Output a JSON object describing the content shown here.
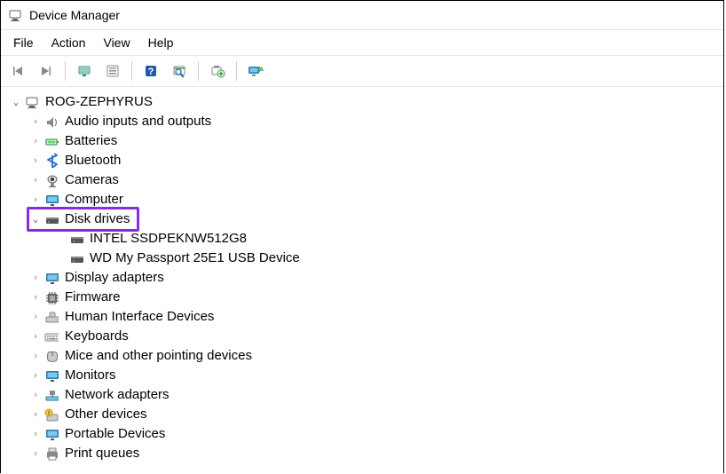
{
  "window": {
    "title": "Device Manager"
  },
  "menu": {
    "items": [
      "File",
      "Action",
      "View",
      "Help"
    ]
  },
  "tree": {
    "root": "ROG-ZEPHYRUS",
    "categories": [
      {
        "label": "Audio inputs and outputs",
        "icon": "speaker"
      },
      {
        "label": "Batteries",
        "icon": "battery"
      },
      {
        "label": "Bluetooth",
        "icon": "bluetooth"
      },
      {
        "label": "Cameras",
        "icon": "camera"
      },
      {
        "label": "Computer",
        "icon": "monitor"
      },
      {
        "label": "Disk drives",
        "icon": "hdd",
        "expanded": true,
        "children": [
          {
            "label": "INTEL SSDPEKNW512G8",
            "icon": "hdd"
          },
          {
            "label": "WD My Passport 25E1 USB Device",
            "icon": "hdd"
          }
        ]
      },
      {
        "label": "Display adapters",
        "icon": "monitor"
      },
      {
        "label": "Firmware",
        "icon": "chip"
      },
      {
        "label": "Human Interface Devices",
        "icon": "hid"
      },
      {
        "label": "Keyboards",
        "icon": "keyboard"
      },
      {
        "label": "Mice and other pointing devices",
        "icon": "mouse"
      },
      {
        "label": "Monitors",
        "icon": "monitor"
      },
      {
        "label": "Network adapters",
        "icon": "network"
      },
      {
        "label": "Other devices",
        "icon": "unknown"
      },
      {
        "label": "Portable Devices",
        "icon": "monitor"
      },
      {
        "label": "Print queues",
        "icon": "printer"
      }
    ]
  }
}
